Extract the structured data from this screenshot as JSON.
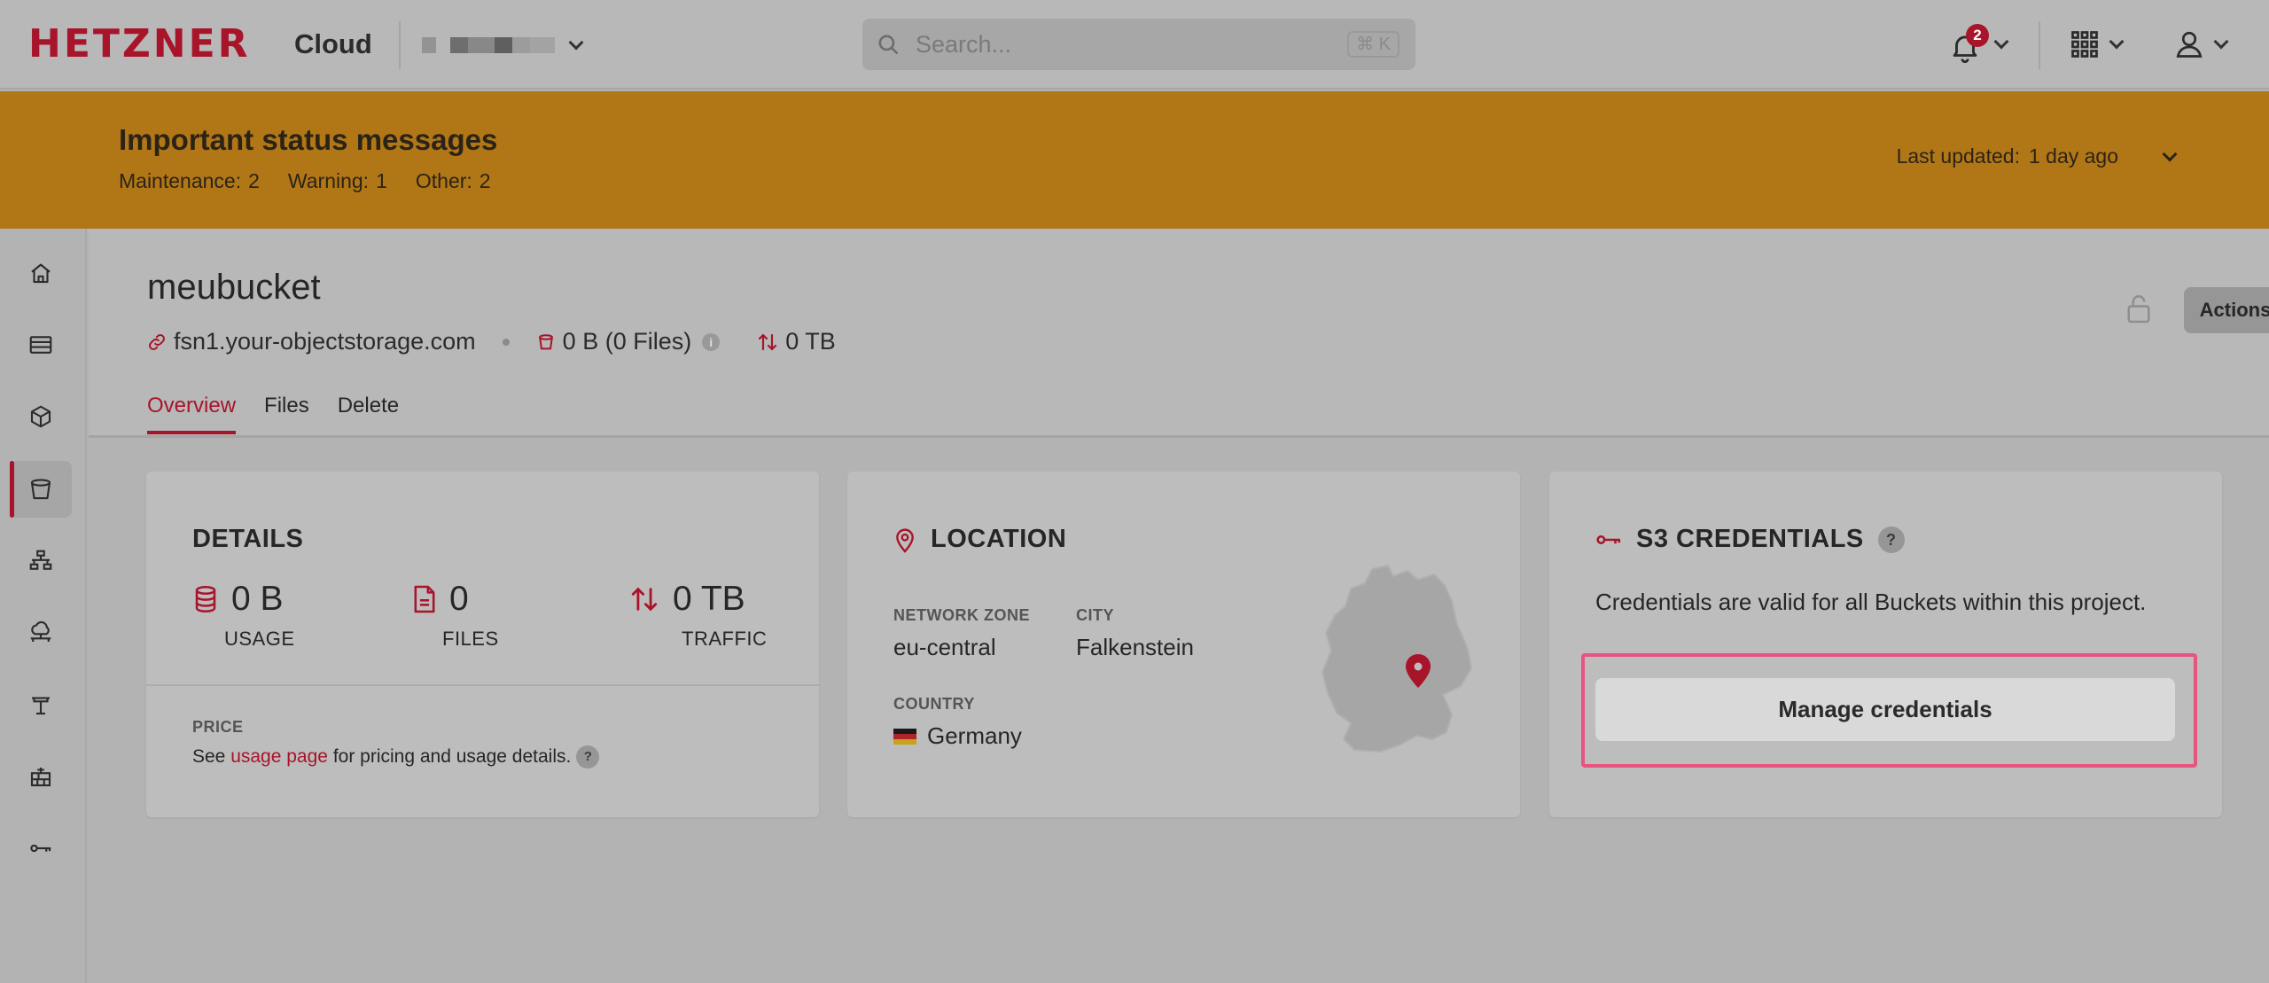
{
  "topbar": {
    "brand": "HETZNER",
    "brand_suffix": "Cloud",
    "search_placeholder": "Search...",
    "search_shortcut": "⌘ K",
    "notification_count": "2"
  },
  "banner": {
    "title": "Important status messages",
    "counts": [
      {
        "label": "Maintenance:",
        "value": "2"
      },
      {
        "label": "Warning:",
        "value": "1"
      },
      {
        "label": "Other:",
        "value": "2"
      }
    ],
    "updated_label": "Last updated:",
    "updated_value": "1 day ago"
  },
  "bucket": {
    "name": "meubucket",
    "endpoint": "fsn1.your-objectstorage.com",
    "storage": "0 B (0 Files)",
    "traffic": "0 TB",
    "actions_label": "Actions"
  },
  "tabs": [
    {
      "label": "Overview",
      "active": true
    },
    {
      "label": "Files",
      "active": false
    },
    {
      "label": "Delete",
      "active": false
    }
  ],
  "details": {
    "title": "DETAILS",
    "usage_value": "0 B",
    "usage_label": "USAGE",
    "files_value": "0",
    "files_label": "FILES",
    "traffic_value": "0 TB",
    "traffic_label": "TRAFFIC",
    "price_label": "PRICE",
    "price_text_before": "See ",
    "price_link": "usage page",
    "price_text_after": " for pricing and usage details.",
    "help": "?"
  },
  "location": {
    "title": "LOCATION",
    "network_zone_label": "NETWORK ZONE",
    "network_zone_value": "eu-central",
    "city_label": "CITY",
    "city_value": "Falkenstein",
    "country_label": "COUNTRY",
    "country_value": "Germany"
  },
  "credentials": {
    "title": "S3 CREDENTIALS",
    "help": "?",
    "description": "Credentials are valid for all Buckets within this project.",
    "button_label": "Manage credentials"
  },
  "colors": {
    "brand_red": "#a8142a",
    "banner": "#b17717",
    "highlight": "#e5557f"
  }
}
